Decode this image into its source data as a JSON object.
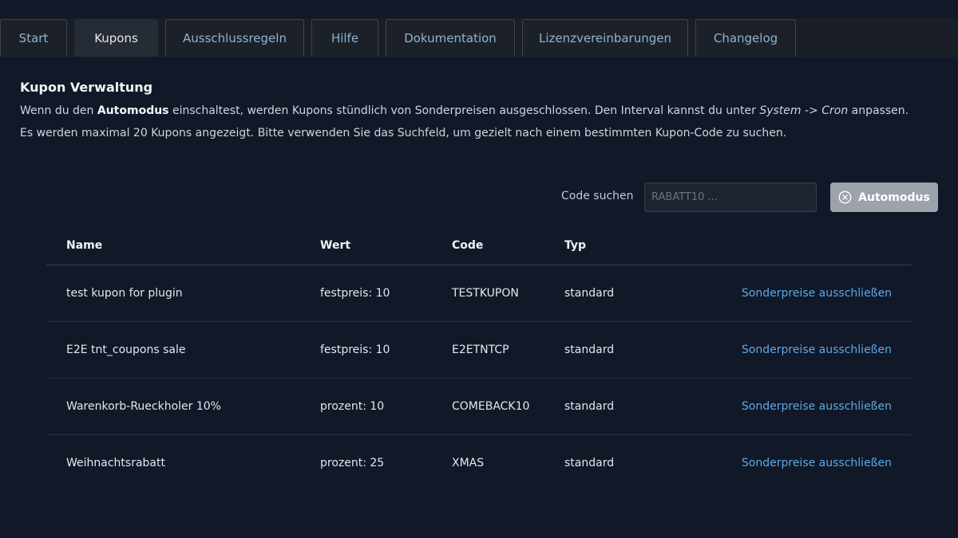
{
  "tabs": [
    {
      "label": "Start",
      "active": false
    },
    {
      "label": "Kupons",
      "active": true
    },
    {
      "label": "Ausschlussregeln",
      "active": false
    },
    {
      "label": "Hilfe",
      "active": false
    },
    {
      "label": "Dokumentation",
      "active": false
    },
    {
      "label": "Lizenzvereinbarungen",
      "active": false
    },
    {
      "label": "Changelog",
      "active": false
    }
  ],
  "page": {
    "title": "Kupon Verwaltung",
    "desc1_pre": "Wenn du den ",
    "desc1_bold": "Automodus",
    "desc1_mid": " einschaltest, werden Kupons stündlich von Sonderpreisen ausgeschlossen. Den Interval kannst du unter ",
    "desc1_italic": "System -> Cron",
    "desc1_post": " anpassen.",
    "desc2": "Es werden maximal 20 Kupons angezeigt. Bitte verwenden Sie das Suchfeld, um gezielt nach einem bestimmten Kupon-Code zu suchen."
  },
  "search": {
    "label": "Code suchen",
    "placeholder": "RABATT10 ...",
    "value": ""
  },
  "automodus": {
    "label": "Automodus",
    "icon": "close-circle-icon"
  },
  "table": {
    "headers": [
      "Name",
      "Wert",
      "Code",
      "Typ"
    ],
    "rows": [
      {
        "name": "test kupon for plugin",
        "wert": "festpreis: 10",
        "code": "TESTKUPON",
        "typ": "standard",
        "action": "Sonderpreise ausschließen"
      },
      {
        "name": "E2E tnt_coupons sale",
        "wert": "festpreis: 10",
        "code": "E2ETNTCP",
        "typ": "standard",
        "action": "Sonderpreise ausschließen"
      },
      {
        "name": "Warenkorb-Rueckholer 10%",
        "wert": "prozent: 10",
        "code": "COMEBACK10",
        "typ": "standard",
        "action": "Sonderpreise ausschließen"
      },
      {
        "name": "Weihnachtsrabatt",
        "wert": "prozent: 25",
        "code": "XMAS",
        "typ": "standard",
        "action": "Sonderpreise ausschließen"
      }
    ]
  },
  "colors": {
    "background": "#111827",
    "link": "#5aa9e6",
    "button": "#9ca3ab"
  }
}
